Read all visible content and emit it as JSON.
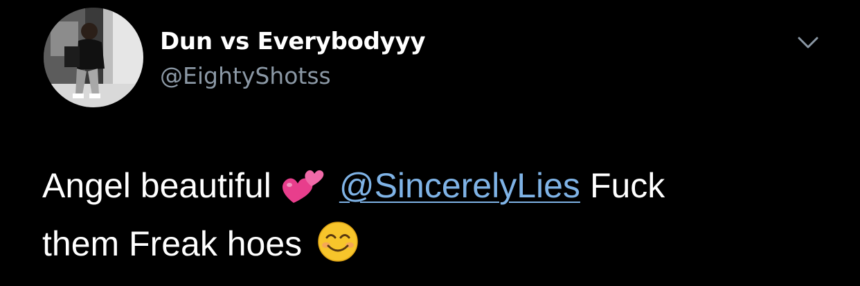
{
  "tweet": {
    "author": {
      "display_name": "Dun vs Everybodyyy",
      "handle": "@EightyShotss",
      "avatar_icon": "profile-photo"
    },
    "more_icon": "chevron-down-icon",
    "text": {
      "part1": "Angel beautiful",
      "emoji1": "two-hearts-emoji",
      "mention": "@SincerelyLies",
      "part2": "Fuck",
      "part3": "them Freak hoes",
      "emoji2": "smiling-face-emoji"
    }
  },
  "colors": {
    "background": "#000000",
    "text": "#ffffff",
    "handle": "#8b98a5",
    "mention": "#7fb3e6",
    "hearts": "#e83e8c"
  }
}
